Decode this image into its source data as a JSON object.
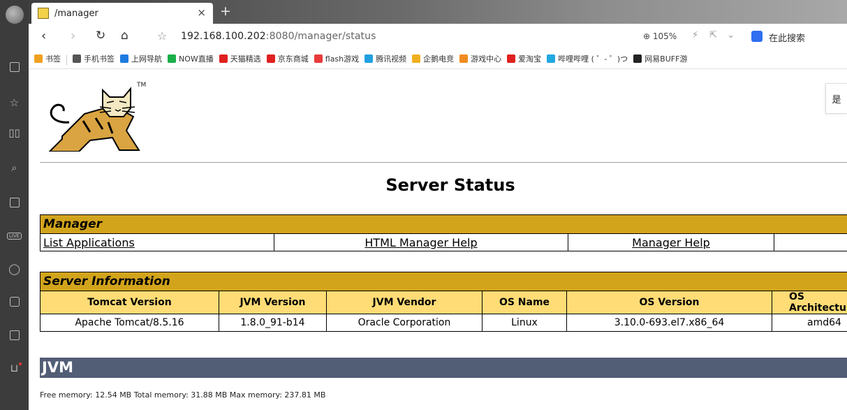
{
  "browser": {
    "tab": {
      "title": "/manager",
      "close": "×"
    },
    "new_tab": "+",
    "address": {
      "host": "192.168.100.202",
      "path": ":8080/manager/status"
    },
    "zoom": "105%",
    "search_placeholder": "在此搜索",
    "bookmarks": [
      {
        "label": "书签",
        "icon": "star-icon",
        "color": "#f0a020"
      },
      {
        "label": "手机书签",
        "icon": "phone-icon",
        "color": "#555555"
      },
      {
        "label": "上网导航",
        "icon": "e-icon",
        "color": "#1e7be0"
      },
      {
        "label": "NOW直播",
        "icon": "now-icon",
        "color": "#19b04a"
      },
      {
        "label": "天猫精选",
        "icon": "tmall-icon",
        "color": "#e02020"
      },
      {
        "label": "京东商城",
        "icon": "jd-icon",
        "color": "#e02020"
      },
      {
        "label": "flash游戏",
        "icon": "flash-icon",
        "color": "#e83a3a"
      },
      {
        "label": "腾讯视频",
        "icon": "video-icon",
        "color": "#20a0e0"
      },
      {
        "label": "企鹅电竞",
        "icon": "penguin-icon",
        "color": "#f0b020"
      },
      {
        "label": "游戏中心",
        "icon": "game-icon",
        "color": "#f08c20"
      },
      {
        "label": "爱淘宝",
        "icon": "taobao-icon",
        "color": "#e02020"
      },
      {
        "label": "哔哩哔哩 ( ゜- ゜)つ",
        "icon": "bilibili-icon",
        "color": "#20a8e0"
      },
      {
        "label": "网易BUFF游",
        "icon": "buff-icon",
        "color": "#222222"
      }
    ]
  },
  "page": {
    "tm": "TM",
    "side_popup": "是",
    "title": "Server Status",
    "manager": {
      "header": "Manager",
      "links": [
        "List Applications",
        "HTML Manager Help",
        "Manager Help",
        ""
      ]
    },
    "server_info": {
      "header": "Server Information",
      "columns": [
        "Tomcat Version",
        "JVM Version",
        "JVM Vendor",
        "OS Name",
        "OS Version",
        "OS Architectur"
      ],
      "values": [
        "Apache Tomcat/8.5.16",
        "1.8.0_91-b14",
        "Oracle Corporation",
        "Linux",
        "3.10.0-693.el7.x86_64",
        "amd64"
      ]
    },
    "jvm": {
      "header": "JVM",
      "memory": "Free memory: 12.54 MB Total memory: 31.88 MB Max memory: 237.81 MB"
    }
  }
}
